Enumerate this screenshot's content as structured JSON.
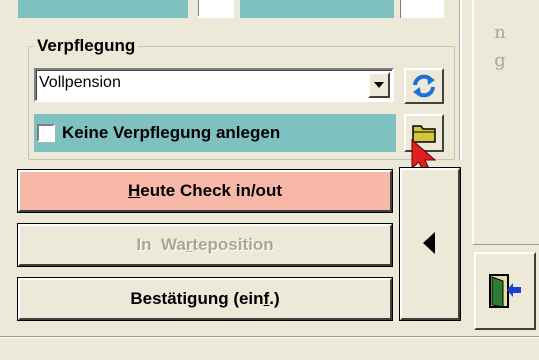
{
  "meals": {
    "title": "Verpflegung",
    "dropdown_value": "Vollpension",
    "checkbox_label": "Keine Verpflegung anlegen",
    "checkbox_checked": false
  },
  "buttons": {
    "checkin_prefix_underlined": "H",
    "checkin_rest": "eute Check in/out",
    "waiting_a": "In  Wa",
    "waiting_underlined": "r",
    "waiting_b": "teposition",
    "confirm_a": "Bestätigung (ein",
    "confirm_underlined": "f",
    "confirm_b": ".)"
  },
  "side_letters": [
    "n",
    "g"
  ],
  "colors": {
    "accent_teal": "#7fc1c1",
    "checkin_bg": "#f8b8a8",
    "cursor_red": "#e02020"
  }
}
